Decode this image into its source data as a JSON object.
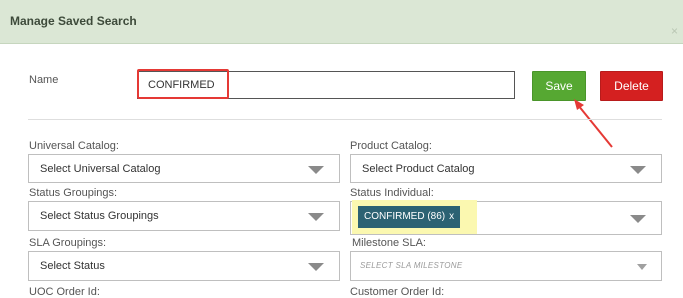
{
  "dialog": {
    "title": "Manage Saved Search",
    "close_glyph": "×"
  },
  "name_field": {
    "label": "Name",
    "value": "CONFIRMED"
  },
  "buttons": {
    "save": "Save",
    "delete": "Delete"
  },
  "fields": {
    "universal_catalog": {
      "label": "Universal Catalog:",
      "value": "Select Universal Catalog"
    },
    "product_catalog": {
      "label": "Product Catalog:",
      "value": "Select Product Catalog"
    },
    "status_groupings": {
      "label": "Status Groupings:",
      "value": "Select Status Groupings"
    },
    "status_individual": {
      "label": "Status Individual:",
      "chip": "CONFIRMED (86)",
      "chip_remove": "x"
    },
    "sla_groupings": {
      "label": "SLA Groupings:",
      "value": "Select Status"
    },
    "milestone_sla": {
      "label": "Milestone SLA:",
      "placeholder": "SELECT SLA MILESTONE"
    },
    "uoc_order_id": {
      "label": "UOC Order Id:"
    },
    "customer_order_id": {
      "label": "Customer Order Id:"
    }
  },
  "colors": {
    "header_bg": "#dbe7d5",
    "save_green": "#56a832",
    "delete_red": "#d42020",
    "chip_teal": "#2c6273",
    "highlight_red": "#e53935",
    "highlight_yellow": "#fbf8b0"
  },
  "icons": {
    "dropdown": "chevron-down-icon",
    "annotation": "red-arrow-icon"
  }
}
